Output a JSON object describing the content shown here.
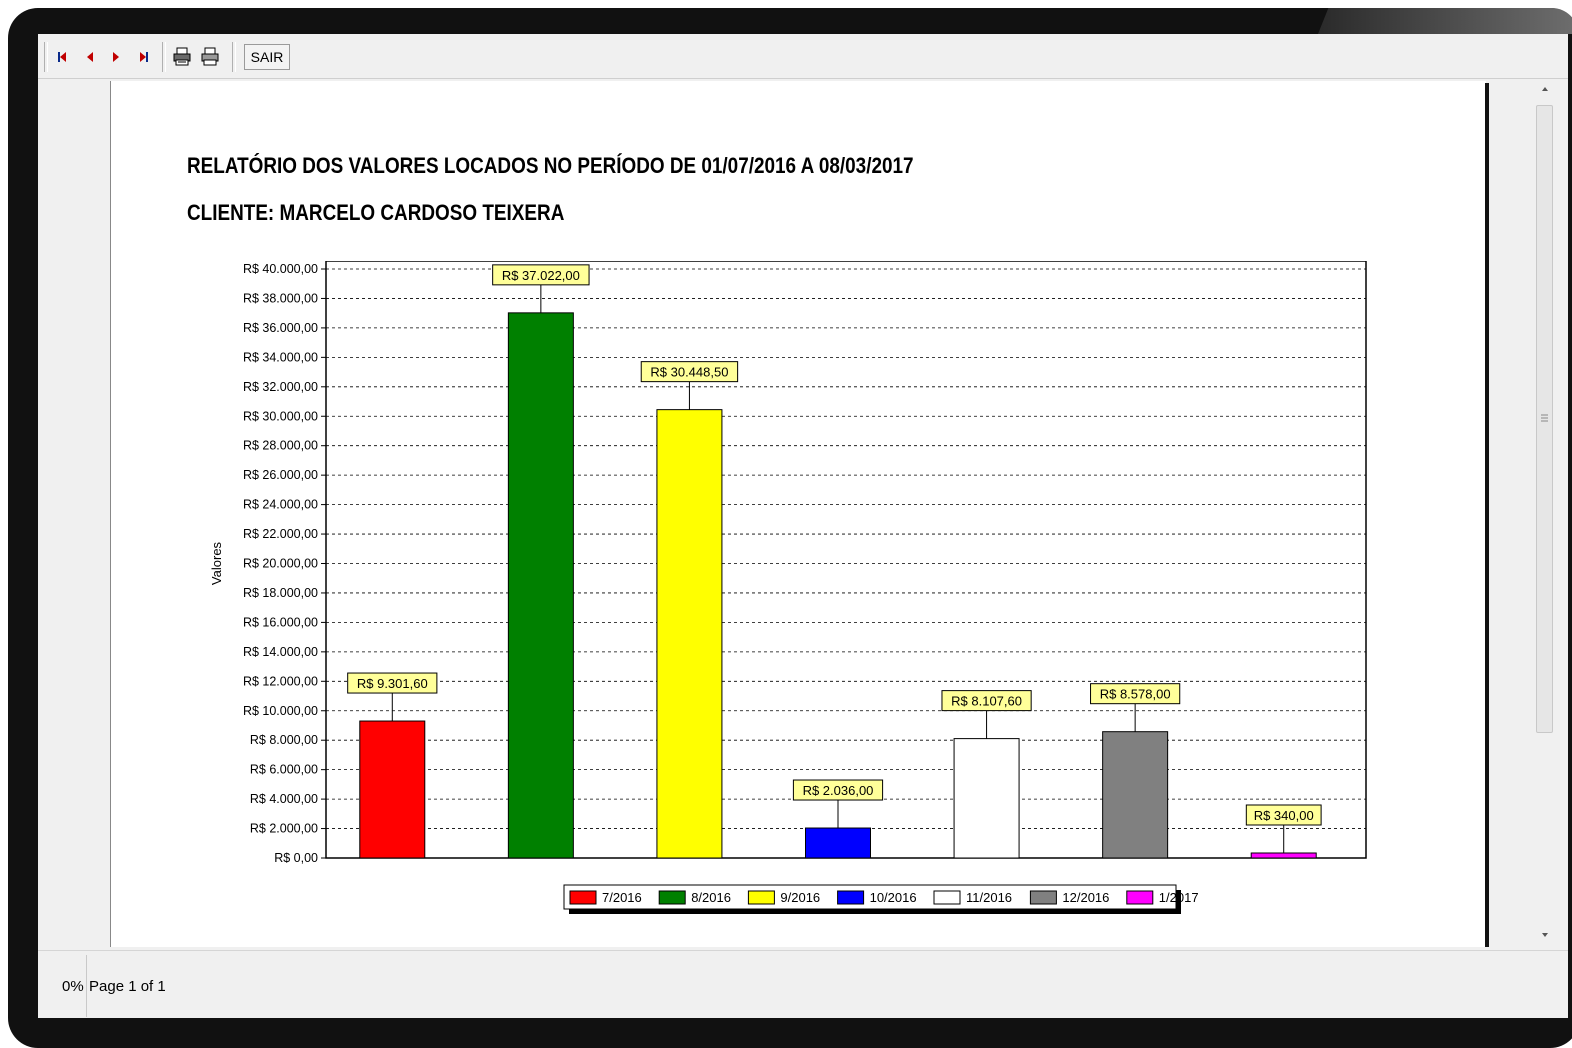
{
  "toolbar": {
    "buttons": [
      {
        "name": "first-page-icon"
      },
      {
        "name": "prev-page-icon"
      },
      {
        "name": "next-page-icon"
      },
      {
        "name": "last-page-icon"
      },
      {
        "name": "print-setup-icon"
      },
      {
        "name": "print-icon"
      }
    ],
    "sair_label": "SAIR"
  },
  "report": {
    "title": "RELATÓRIO DOS VALORES LOCADOS NO PERÍODO DE 01/07/2016 A 08/03/2017",
    "client": "CLIENTE: MARCELO CARDOSO TEIXERA"
  },
  "status": {
    "zoom": "0%",
    "page": "Page 1 of 1"
  },
  "chart_data": {
    "type": "bar",
    "ylabel": "Valores",
    "ylim": [
      0,
      40000
    ],
    "grid": true,
    "legend_position": "bottom",
    "y_ticks": [
      "R$ 0,00",
      "R$ 2.000,00",
      "R$ 4.000,00",
      "R$ 6.000,00",
      "R$ 8.000,00",
      "R$ 10.000,00",
      "R$ 12.000,00",
      "R$ 14.000,00",
      "R$ 16.000,00",
      "R$ 18.000,00",
      "R$ 20.000,00",
      "R$ 22.000,00",
      "R$ 24.000,00",
      "R$ 26.000,00",
      "R$ 28.000,00",
      "R$ 30.000,00",
      "R$ 32.000,00",
      "R$ 34.000,00",
      "R$ 36.000,00",
      "R$ 38.000,00",
      "R$ 40.000,00"
    ],
    "categories": [
      "7/2016",
      "8/2016",
      "9/2016",
      "10/2016",
      "11/2016",
      "12/2016",
      "1/2017"
    ],
    "values": [
      9301.6,
      37022.0,
      30448.5,
      2036.0,
      8107.6,
      8578.0,
      340.0
    ],
    "labels": [
      "R$ 9.301,60",
      "R$ 37.022,00",
      "R$ 30.448,50",
      "R$ 2.036,00",
      "R$ 8.107,60",
      "R$ 8.578,00",
      "R$ 340,00"
    ],
    "colors": [
      "#ff0000",
      "#008000",
      "#ffff00",
      "#0000ff",
      "#ffffff",
      "#808080",
      "#ff00ff"
    ],
    "label_color": "#ffff99"
  }
}
